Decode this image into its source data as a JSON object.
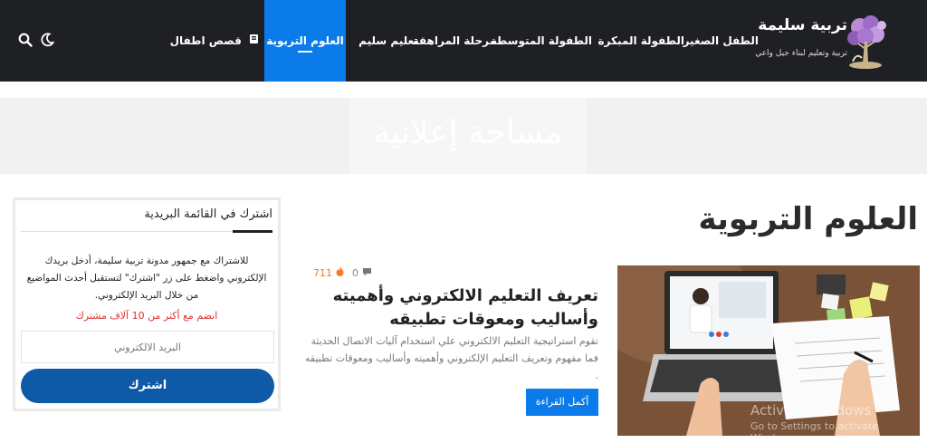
{
  "header": {
    "logo_title": "تربية سليمة",
    "logo_tagline": "تربية وتعليم لبناء جيل واعي",
    "nav_items": [
      {
        "label": "الطفل الصغير"
      },
      {
        "label": "الطفولة المبكرة"
      },
      {
        "label": "الطفولة المتوسطة"
      },
      {
        "label": "مرحلة المراهقة"
      },
      {
        "label": "تعليم سليم"
      },
      {
        "label": "العلوم التربوية",
        "active": true
      },
      {
        "label": "قصص اطفال"
      }
    ],
    "icons": [
      "book-icon",
      "moon-icon",
      "search-icon"
    ]
  },
  "ad": {
    "text": "مساحة إعلانية"
  },
  "page": {
    "title": "العلوم التربوية"
  },
  "post": {
    "comments": "0",
    "views": "711",
    "title": "تعريف التعليم الالكتروني وأهميته وأساليب ومعوقات تطبيقه",
    "excerpt": "تقوم استراتيجية التعليم الالكتروني علي استخدام آليات الاتصال الحديثة فما مفهوم وتعريف التعليم الإلكتروني وأهميته وأساليب ومعوقات تطبيقه .",
    "read_more": "أكمل القراءة"
  },
  "newsletter": {
    "title": "اشترك في القائمة البريدية",
    "description": "للاشتراك مع جمهور مدونة تربية سليمة، أدخل بريدك الإلكتروني واضغط على زر \"اشترك\" لتستقبل أحدث المواضيع من خلال البريد الإلكتروني.",
    "join_text": "انضم مع أكثر من 10 آلاف مشترك",
    "email_placeholder": "البريد الالكتروني",
    "button": "اشترك"
  },
  "watermark": {
    "line1": "Activate Windows",
    "line2": "Go to Settings to activate Windows."
  },
  "colors": {
    "header_bg": "#1f2024",
    "accent": "#0b7bea",
    "subscribe": "#0e5aa6",
    "join_text": "#dd3333"
  }
}
